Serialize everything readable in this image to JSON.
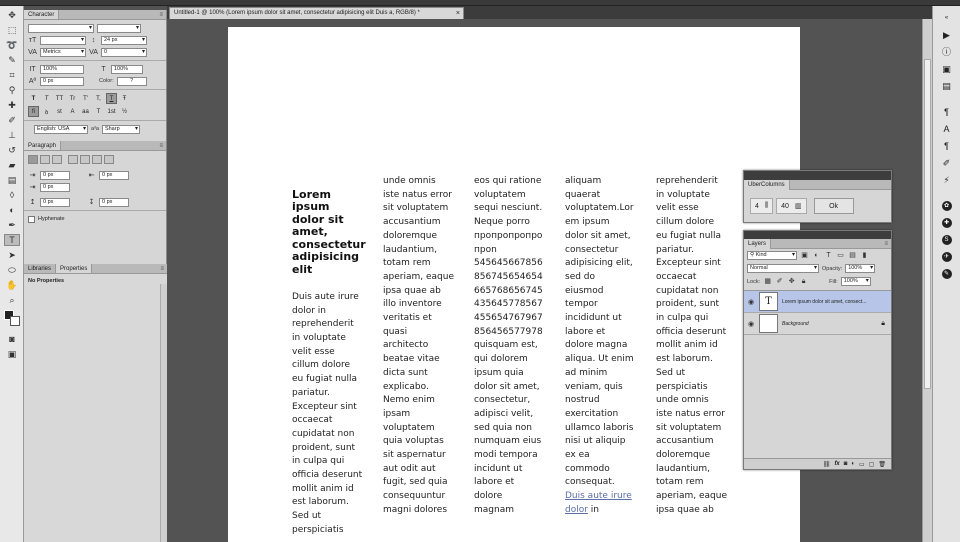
{
  "document": {
    "tab_title": "Untitled-1 @ 100% (Lorem ipsum dolor sit amet, consectetur adipisicing elit Duis a, RGB/8) *",
    "close_glyph": "×"
  },
  "character_panel": {
    "tab": "Character",
    "font_size": "24 px",
    "kerning": "Metrics",
    "tracking": "0",
    "vertical_scale": "100%",
    "horizontal_scale": "100%",
    "baseline_shift": "0 px",
    "color_label": "Color:",
    "color_value": "?",
    "style_buttons": [
      "T",
      "T",
      "TT",
      "Tr",
      "T'",
      "T,",
      "T",
      "Ŧ"
    ],
    "opentype_buttons": [
      "fi",
      "ꝺ",
      "st",
      "A",
      "aa",
      "T",
      "1st",
      "½"
    ],
    "language": "English: USA",
    "antialias": "Sharp",
    "antialias_label": "a³a"
  },
  "paragraph_panel": {
    "tab": "Paragraph",
    "indent_left": "0 px",
    "indent_right": "0 px",
    "first_line": "0 px",
    "space_before": "0 px",
    "space_after": "0 px",
    "hyphenate_label": "Hyphenate"
  },
  "properties_panel": {
    "tab_libraries": "Libraries",
    "tab_properties": "Properties",
    "message": "No Properties"
  },
  "columns": {
    "col1_title": "Lorem\nipsum\ndolor sit\namet,\nconsectetur\nadipisicing\nelit",
    "col1_body": "Duis aute irure\ndolor in\nreprehenderit\nin voluptate\nvelit esse\ncillum dolore\neu fugiat nulla\npariatur.\nExcepteur sint\noccaecat\ncupidatat non\nproident, sunt\nin culpa qui\nofficia deserunt\nmollit anim id\nest laborum.\nSed ut\nperspiciatis",
    "col2": "unde omnis\niste natus error\nsit voluptatem\naccusantium\ndoloremque\nlaudantium,\ntotam rem\naperiam, eaque\nipsa quae ab\nillo inventore\nveritatis et\nquasi\narchitecto\nbeatae vitae\ndicta sunt\nexplicabo.\nNemo enim\nipsam\nvoluptatem\nquia voluptas\nsit aspernatur\naut odit aut\nfugit, sed quia\nconsequuntur\nmagni dolores",
    "col3": "eos qui ratione\nvoluptatem\nsequi nesciunt.\nNeque porro\nпропропропро\nпрon\n545645667856\n856745654654\n665768656745\n435645778567\n455654767967\n856456577978\nquisquam est,\nqui dolorem\nipsum quia\ndolor sit amet,\nconsectetur,\nadipisci velit,\nsed quia non\nnumquam eius\nmodi tempora\nincidunt ut\nlabore et\ndolore\nmagnam",
    "col4_body": "aliquam\nquaerat\nvoluptatem.Lor\nem ipsum\ndolor sit amet,\nconsectetur\nadipisicing elit,\nsed do\neiusmod\ntempor\nincididunt ut\nlabore et\ndolore magna\naliqua. Ut enim\nad minim\nveniam, quis\nnostrud\nexercitation\nullamco laboris\nnisi ut aliquip\nex ea\ncommodo\nconsequat.",
    "col4_link1": "Duis aute irure",
    "col4_link2": "dolor",
    "col4_tail": " in",
    "col5": "reprehenderit\nin voluptate\nvelit esse\ncillum dolore\neu fugiat nulla\npariatur.\nExcepteur sint\noccaecat\ncupidatat non\nproident, sunt\nin culpa qui\nofficia deserunt\nmollit anim id\nest laborum.\nSed ut\nperspiciatis\nunde omnis\niste natus error\nsit voluptatem\naccusantium\ndoloremque\nlaudantium,\ntotam rem\naperiam, eaque\nipsa quae ab"
  },
  "uber_columns": {
    "title": "UberColumns",
    "columns_value": "4",
    "gutter_value": "40",
    "ok_label": "Ok"
  },
  "layers_panel": {
    "title": "Layers",
    "filter_kind": "Kind",
    "blend_mode": "Normal",
    "opacity_label": "Opacity:",
    "opacity_value": "100%",
    "lock_label": "Lock:",
    "fill_label": "Fill:",
    "fill_value": "100%",
    "layers": [
      {
        "name": "Lorem ipsum dolor sit amet, consect...",
        "thumb": "T",
        "selected": true
      },
      {
        "name": "Background",
        "thumb": "",
        "selected": false
      }
    ],
    "footer_icons": [
      "link-icon",
      "fx-icon",
      "mask-icon",
      "adjustment-icon",
      "folder-icon",
      "new-layer-icon",
      "trash-icon"
    ],
    "fx_label": "fx"
  },
  "colors": {
    "ui_background": "#535353",
    "panel": "#d6d6d6",
    "selected_layer": "#b7c6e8",
    "link": "#5a6fa8"
  }
}
